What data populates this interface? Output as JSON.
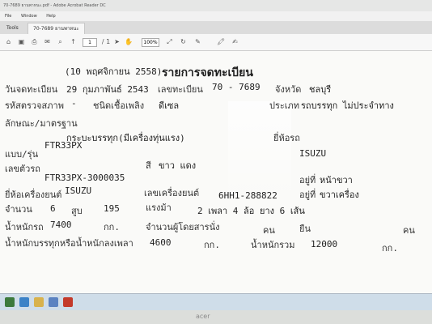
{
  "window": {
    "title": "70-7689 ยานพาหนะ.pdf - Adobe Acrobat Reader DC",
    "menu": [
      "File",
      "Window",
      "Help"
    ]
  },
  "tabs": {
    "tools": "Tools",
    "document": "70-7689 ยานพาหนะ"
  },
  "toolbar": {
    "page": "1",
    "page_total": "/ 1",
    "zoom": "100%"
  },
  "document": {
    "date": "(10 พฤศจิกายน 2558)",
    "title": "รายการจดทะเบียน",
    "reg_date_label": "วันจดทะเบียน",
    "reg_date": "29 กุมภาพันธ์ 2543",
    "plate_label": "เลขทะเบียน",
    "plate": "70 - 7689",
    "province_label": "จังหวัด",
    "province": "ชลบุรี",
    "type_code_label": "รหัสตรวจสภาพ",
    "type_code": "-",
    "fuel_label": "ชนิดเชื้อเพลิง",
    "fuel": "ดีเซล",
    "vehicle_type_label": "ประเภท",
    "vehicle_type": "รถบรรทุก ไม่ประจำทาง",
    "body_label": "ลักษณะ/มาตรฐาน",
    "body": "กระบะบรรทุก(มีเครื่องทุ่นแรง)",
    "brand_label": "ยี่ห้อรถ",
    "brand": "ISUZU",
    "model_label": "แบบ/รุ่น",
    "model": "FTR33PX",
    "color_label": "สี",
    "color": "ขาว แดง",
    "chassis_label": "เลขตัวรถ",
    "chassis": "FTR33PX-3000035",
    "chassis_pos_label": "อยู่ที่",
    "chassis_pos": "หน้าขวา",
    "engine_brand_label": "ยี่ห้อเครื่องยนต์",
    "engine_brand": "ISUZU",
    "engine_no_label": "เลขเครื่องยนต์",
    "engine_no": "6HH1-288822",
    "engine_pos_label": "อยู่ที่",
    "engine_pos": "ขวาเครื่อง",
    "qty_label": "จำนวน",
    "cylinders": "6",
    "cyl_unit": "สูบ",
    "cc": "195",
    "hp_label": "แรงม้า",
    "axles": "2 เพลา 4 ล้อ ยาง 6 เส้น",
    "weight_label": "น้ำหนักรถ",
    "weight": "7400",
    "kg": "กก.",
    "seats_label": "จำนวนผู้โดยสารนั่ง",
    "person": "คน",
    "stand_label": "ยืน",
    "person2": "คน",
    "load_label": "น้ำหนักบรรทุกหรือน้ำหนักลงเพลา",
    "load": "4600",
    "kg2": "กก.",
    "total_label": "น้ำหนักรวม",
    "total": "12000",
    "kg3": "กก."
  },
  "monitor": {
    "brand": "acer"
  }
}
